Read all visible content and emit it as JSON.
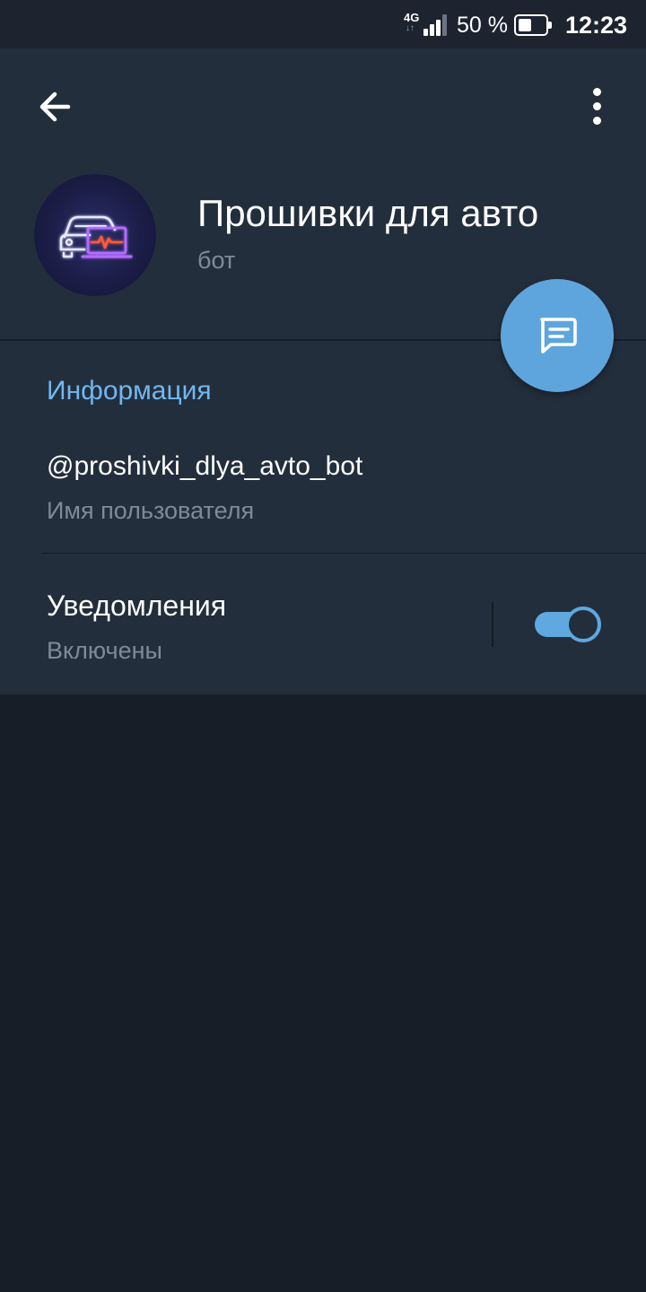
{
  "status_bar": {
    "network": "4G",
    "network_arrows": "↓↑",
    "battery_percent": "50 %",
    "battery_level": 0.5,
    "time": "12:23"
  },
  "header": {
    "back_icon": "arrow-left-icon",
    "menu_icon": "more-vertical-icon",
    "title": "Прошивки для авто",
    "subtitle": "бот",
    "avatar_icon": "car-laptop-neon-logo"
  },
  "info": {
    "section_title": "Информация",
    "username": "@proshivki_dlya_avto_bot",
    "username_caption": "Имя пользователя",
    "notifications_label": "Уведомления",
    "notifications_status": "Включены",
    "notifications_enabled": true
  },
  "fab": {
    "icon": "message-icon"
  },
  "colors": {
    "background": "#181e28",
    "panel": "#232e3c",
    "accent": "#5ea5dd",
    "section_title": "#71b8f0",
    "secondary_text": "#7d8b99"
  }
}
